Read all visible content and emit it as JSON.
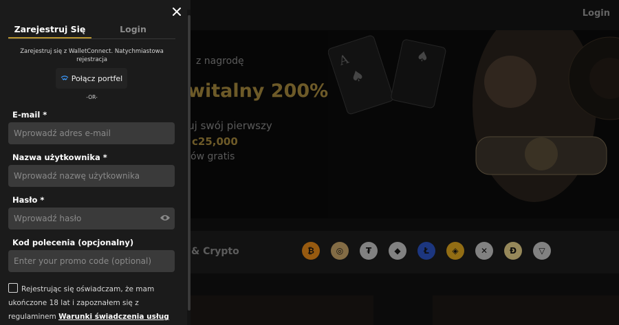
{
  "background": {
    "header": {
      "login_label": "Login"
    },
    "hero": {
      "subtitle": "z nagrodę",
      "title": "witalny 200%",
      "line1": "luj swój pierwszy",
      "amount": "c25,000",
      "line2": "ów gratis"
    },
    "crypto": {
      "label": "& Crypto",
      "coins": [
        {
          "name": "bitcoin-icon",
          "symbol": "₿",
          "color": "#e88a1a"
        },
        {
          "name": "gold-coin-icon",
          "symbol": "◎",
          "color": "#c9a66b"
        },
        {
          "name": "tether-icon",
          "symbol": "₮",
          "color": "#c7c7c7"
        },
        {
          "name": "ethereum-icon",
          "symbol": "◆",
          "color": "#c7c7c7"
        },
        {
          "name": "litecoin-icon",
          "symbol": "Ł",
          "color": "#2c54c4"
        },
        {
          "name": "binance-icon",
          "symbol": "◈",
          "color": "#e0a820"
        },
        {
          "name": "xrp-icon",
          "symbol": "✕",
          "color": "#c7c7c7"
        },
        {
          "name": "dogecoin-icon",
          "symbol": "Ð",
          "color": "#e6d28a"
        },
        {
          "name": "tron-icon",
          "symbol": "▽",
          "color": "#c7c7c7"
        }
      ]
    }
  },
  "modal": {
    "tabs": [
      {
        "label": "Zarejestruj Się",
        "active": true
      },
      {
        "label": "Login",
        "active": false
      }
    ],
    "intro_text": "Zarejestruj się z WalletConnect. Natychmiastowa rejestracja",
    "wallet_button_label": "Połącz portfel",
    "or_label": "-OR-",
    "email": {
      "label": "E-mail *",
      "placeholder": "Wprowadź adres e-mail"
    },
    "username": {
      "label": "Nazwa użytkownika *",
      "placeholder": "Wprowadź nazwę użytkownika"
    },
    "password": {
      "label": "Hasło *",
      "placeholder": "Wprowadź hasło"
    },
    "referral": {
      "label": "Kod polecenia (opcjonalny)",
      "placeholder": "Enter your promo code (optional)"
    },
    "terms": {
      "text": "Rejestrując się oświadczam, że mam ukończone 18 lat i zapoznałem się z regulaminem",
      "link": "Warunki świadczenia usług"
    }
  },
  "colors": {
    "accent_gold": "#b8942f",
    "modal_bg": "#1b1b1b",
    "field_bg": "#3a3a3a"
  }
}
